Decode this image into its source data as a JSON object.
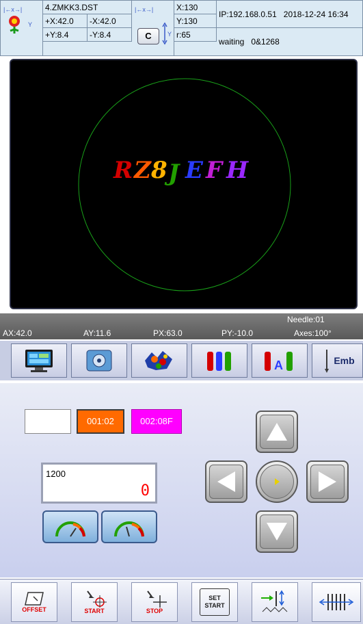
{
  "header": {
    "filename": "4.ZMKK3.DST",
    "plus_x": "+X:42.0",
    "minus_x": "-X:42.0",
    "plus_y": "+Y:8.4",
    "minus_y": "-Y:8.4",
    "c_label": "C",
    "x_val": "X:130",
    "y_val": "Y:130",
    "r_val": "r:65",
    "ip": "IP:192.168.0.51",
    "datetime": "2018-12-24 16:34",
    "status": "waiting",
    "counter": "0&1268"
  },
  "preview": {
    "design_text": "RZ8JEFH",
    "letter_colors": [
      "#d40000",
      "#ff5a00",
      "#ffb300",
      "#22a000",
      "#2a3cff",
      "#c21fd6",
      "#9a28ff"
    ],
    "hoop_color": "#19a019"
  },
  "status_bar": {
    "ax": "AX:42.0",
    "ay": "AY:11.6",
    "px": "PX:63.0",
    "py": "PY:-10.0",
    "needle": "Needle:01",
    "axes": "Axes:100°"
  },
  "toolbar": {
    "items": [
      {
        "icon": "monitor-icon"
      },
      {
        "icon": "settings-panel-icon"
      },
      {
        "icon": "embroidery-design-icon"
      },
      {
        "icon": "thread-spools-icon"
      },
      {
        "icon": "thread-spool-a-icon",
        "label": "A"
      },
      {
        "icon": "needle-emb-icon",
        "label": "Emb"
      }
    ]
  },
  "main": {
    "color_box_value": "",
    "orange_box": "001:02",
    "magenta_box": "002:08F",
    "speed_label": "1200",
    "speed_value": "0",
    "gauges": [
      "speed-down-gauge-icon",
      "speed-up-gauge-icon"
    ],
    "arrows": [
      "arrow-up-icon",
      "arrow-left-icon",
      "center-icon",
      "arrow-right-icon",
      "arrow-down-icon"
    ]
  },
  "bottom_bar": {
    "offset": "OFFSET",
    "start": "START",
    "stop": "STOP",
    "set_top": "SET",
    "set_bottom": "START"
  }
}
